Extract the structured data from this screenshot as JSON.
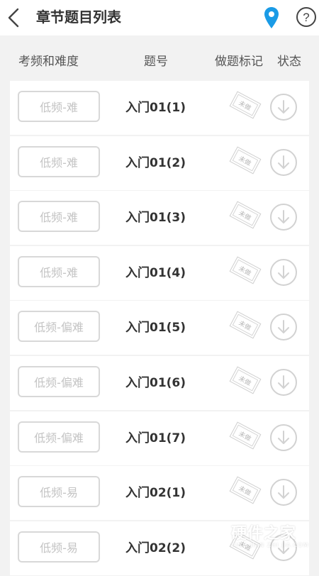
{
  "header": {
    "title": "章节题目列表",
    "icons": {
      "back": "chevron-left-icon",
      "location": "location-pin-icon",
      "help": "help-circle-icon"
    },
    "location_color": "#1a9be6",
    "help_symbol": "?"
  },
  "columns": {
    "frequency": "考频和难度",
    "question": "题号",
    "mark": "做题标记",
    "status": "状态"
  },
  "questions": [
    {
      "frequency": "低频-难",
      "number": "入门01(1)",
      "mark": "未做"
    },
    {
      "frequency": "低频-难",
      "number": "入门01(2)",
      "mark": "未做"
    },
    {
      "frequency": "低频-难",
      "number": "入门01(3)",
      "mark": "未做"
    },
    {
      "frequency": "低频-难",
      "number": "入门01(4)",
      "mark": "未做"
    },
    {
      "frequency": "低频-偏难",
      "number": "入门01(5)",
      "mark": "未做"
    },
    {
      "frequency": "低频-偏难",
      "number": "入门01(6)",
      "mark": "未做"
    },
    {
      "frequency": "低频-偏难",
      "number": "入门01(7)",
      "mark": "未做"
    },
    {
      "frequency": "低频-易",
      "number": "入门02(1)",
      "mark": "未做"
    },
    {
      "frequency": "低频-易",
      "number": "入门02(2)",
      "mark": "未做"
    }
  ],
  "status_icon": "download-icon",
  "watermark": {
    "text": "硬件之家",
    "subtext": "YING JIAN ZHI JIA.COM"
  }
}
